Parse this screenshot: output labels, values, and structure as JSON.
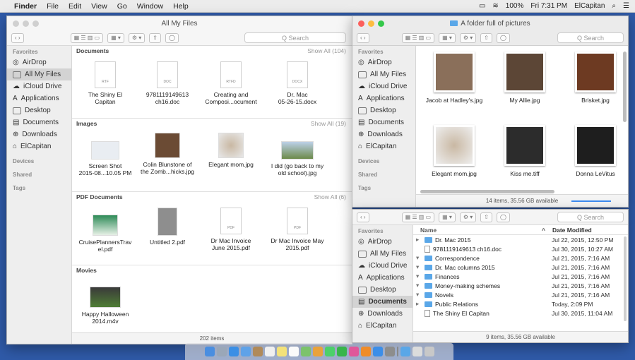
{
  "menubar": {
    "app": "Finder",
    "items": [
      "File",
      "Edit",
      "View",
      "Go",
      "Window",
      "Help"
    ],
    "battery": "100%",
    "clock": "Fri 7:31 PM",
    "user": "ElCapitan"
  },
  "main_window": {
    "title": "All My Files",
    "search_placeholder": "Q Search",
    "sidebar": {
      "favorites_header": "Favorites",
      "favorites": [
        "AirDrop",
        "All My Files",
        "iCloud Drive",
        "Applications",
        "Desktop",
        "Documents",
        "Downloads",
        "ElCapitan"
      ],
      "devices_header": "Devices",
      "shared_header": "Shared",
      "tags_header": "Tags"
    },
    "sections": {
      "documents": {
        "title": "Documents",
        "show_all": "Show All (104)",
        "items": [
          {
            "line1": "The Shiny El",
            "line2": "Capitan",
            "ext": "RTF"
          },
          {
            "line1": "9781119149613",
            "line2": "ch16.doc",
            "ext": "DOC"
          },
          {
            "line1": "Creating and",
            "line2": "Composi...ocument",
            "ext": "RTFD"
          },
          {
            "line1": "Dr. Mac",
            "line2": "05-26-15.docx",
            "ext": "DOCX"
          }
        ]
      },
      "images": {
        "title": "Images",
        "show_all": "Show All (19)",
        "items": [
          {
            "line1": "Screen Shot",
            "line2": "2015-08...10.05 PM"
          },
          {
            "line1": "Colin Blunstone of",
            "line2": "the Zomb...hicks.jpg"
          },
          {
            "line1": "Elegant mom.jpg",
            "line2": ""
          },
          {
            "line1": "I did (go back to my",
            "line2": "old school).jpg"
          }
        ]
      },
      "pdf": {
        "title": "PDF Documents",
        "show_all": "Show All (6)",
        "items": [
          {
            "line1": "CruisePlannersTrav",
            "line2": "el.pdf"
          },
          {
            "line1": "Untitled 2.pdf",
            "line2": ""
          },
          {
            "line1": "Dr Mac Invoice",
            "line2": "June 2015.pdf"
          },
          {
            "line1": "Dr Mac Invoice May",
            "line2": "2015.pdf"
          }
        ]
      },
      "movies": {
        "title": "Movies",
        "items": [
          {
            "line1": "Happy Halloween",
            "line2": "2014.m4v"
          }
        ]
      }
    },
    "status": "202 items"
  },
  "pictures_window": {
    "title": "A folder full of pictures",
    "search_placeholder": "Q Search",
    "items": [
      "Jacob at Hadley's.jpg",
      "My Allie.jpg",
      "Brisket.jpg",
      "Elegant mom.jpg",
      "Kiss me.tiff",
      "Donna LeVitus"
    ],
    "status": "14 items, 35.56 GB available"
  },
  "list_window": {
    "search_placeholder": "Q Search",
    "col_name": "Name",
    "col_date": "Date Modified",
    "rows": [
      {
        "name": "Dr. Mac 2015",
        "date": "Jul 22, 2015, 12:50 PM",
        "kind": "folder-stack"
      },
      {
        "name": "9781119149613 ch16.doc",
        "date": "Jul 30, 2015, 10:27 AM",
        "kind": "doc"
      },
      {
        "name": "Correspondence",
        "date": "Jul 21, 2015, 7:16 AM",
        "kind": "folder"
      },
      {
        "name": "Dr. Mac columns 2015",
        "date": "Jul 21, 2015, 7:16 AM",
        "kind": "folder"
      },
      {
        "name": "Finances",
        "date": "Jul 21, 2015, 7:16 AM",
        "kind": "folder"
      },
      {
        "name": "Money-making schemes",
        "date": "Jul 21, 2015, 7:16 AM",
        "kind": "folder"
      },
      {
        "name": "Novels",
        "date": "Jul 21, 2015, 7:16 AM",
        "kind": "folder"
      },
      {
        "name": "Public Relations",
        "date": "Today, 2:09 PM",
        "kind": "folder"
      },
      {
        "name": "The Shiny El Capitan",
        "date": "Jul 30, 2015, 11:04 AM",
        "kind": "doc"
      }
    ],
    "sidebar_items": [
      "AirDrop",
      "All My Files",
      "iCloud Drive",
      "Applications",
      "Desktop",
      "Documents",
      "Downloads",
      "ElCapitan"
    ],
    "favorites_header": "Favorites",
    "status": "9 items, 35.56 GB available"
  },
  "colors": {
    "desktop": "#2f5aa8",
    "folder": "#5aa7e8",
    "selection": "#d3d3d3",
    "close": "#fc605c",
    "min": "#fdbc40",
    "max": "#34c84a"
  }
}
